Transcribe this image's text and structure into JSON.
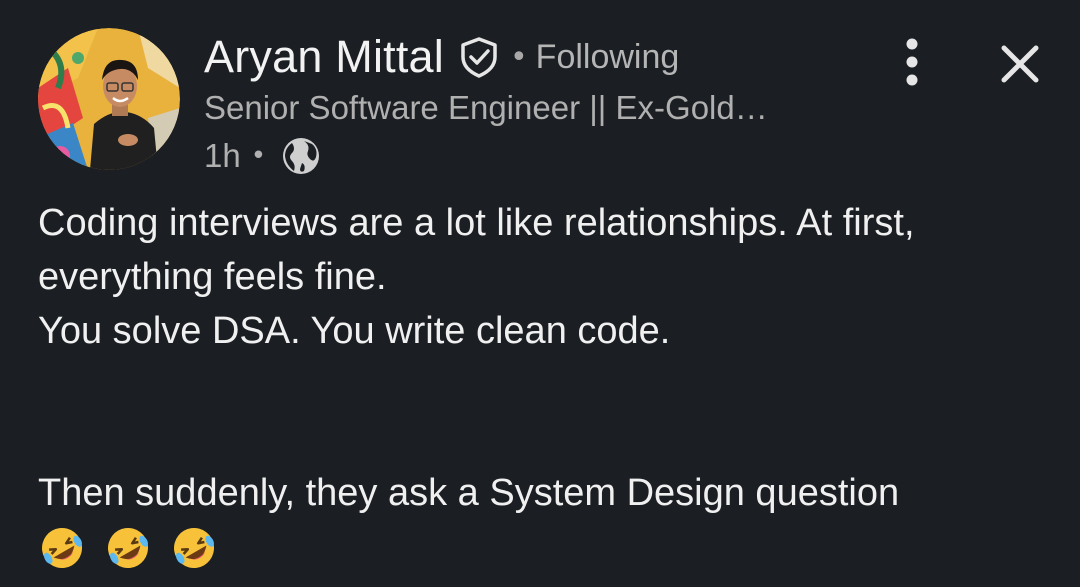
{
  "author": {
    "name": "Aryan Mittal",
    "follow_status": "Following",
    "headline": "Senior Software Engineer || Ex-Gold…",
    "separator": "•"
  },
  "meta": {
    "time": "1h",
    "separator": "•",
    "visibility_icon": "globe-icon"
  },
  "icons": {
    "verified": "verified-shield-icon",
    "more": "more-vertical-icon",
    "close": "close-icon",
    "emoji": "rolling-on-floor-laughing-emoji"
  },
  "post": {
    "paragraph_1": "Coding interviews are a lot like relationships. At first, everything feels fine.",
    "paragraph_2": "You solve DSA. You write clean code.",
    "paragraph_3": "Then suddenly, they ask a System Design question",
    "emoji_count": 3
  },
  "colors": {
    "background": "#1b1f23",
    "primary_text": "#f0f0f0",
    "secondary_text": "#b0b0b0"
  }
}
